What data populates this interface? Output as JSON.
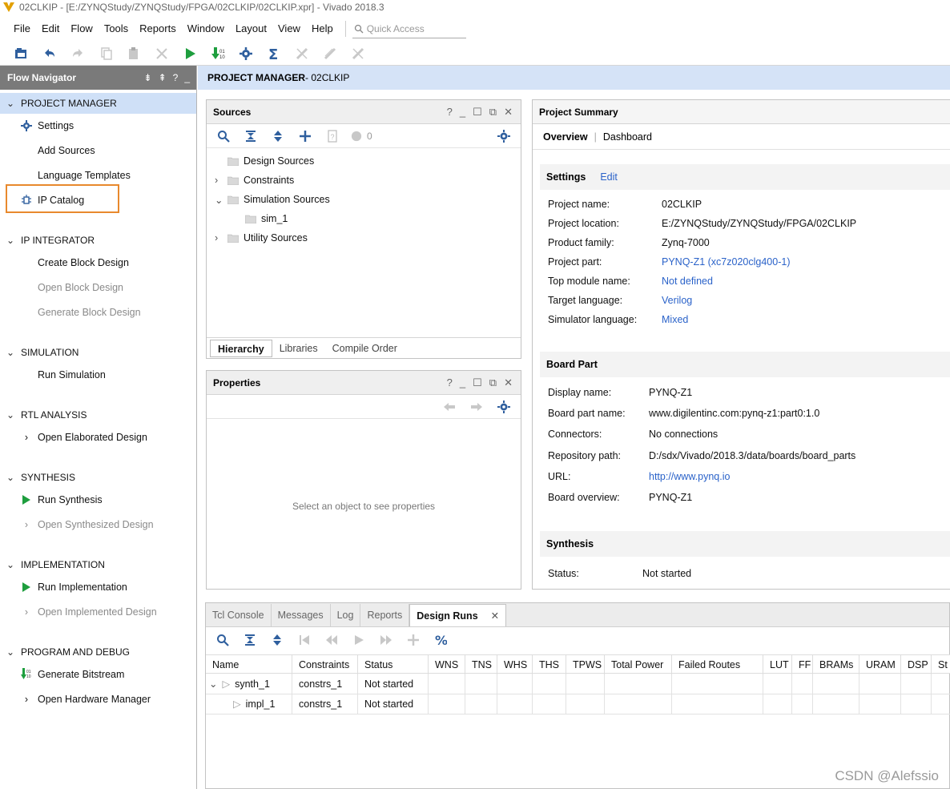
{
  "window": {
    "title": "02CLKIP - [E:/ZYNQStudy/ZYNQStudy/FPGA/02CLKIP/02CLKIP.xpr] - Vivado 2018.3"
  },
  "menu": {
    "items": [
      "File",
      "Edit",
      "Flow",
      "Tools",
      "Reports",
      "Window",
      "Layout",
      "View",
      "Help"
    ],
    "quick_access": "Quick Access"
  },
  "toolbar": {
    "icons": [
      "open-project-icon",
      "undo-icon",
      "redo-icon",
      "copy-icon",
      "paste-icon",
      "delete-icon",
      "run-icon",
      "generate-bitstream-icon",
      "settings-icon",
      "sigma-icon",
      "disabled-tool-1-icon",
      "disabled-tool-2-icon",
      "disabled-tool-3-icon"
    ]
  },
  "flow_nav": {
    "title": "Flow Navigator",
    "sections": {
      "project_manager": "PROJECT MANAGER",
      "ip_integrator": "IP INTEGRATOR",
      "simulation": "SIMULATION",
      "rtl_analysis": "RTL ANALYSIS",
      "synthesis": "SYNTHESIS",
      "implementation": "IMPLEMENTATION",
      "program_debug": "PROGRAM AND DEBUG"
    },
    "items": {
      "settings": "Settings",
      "add_sources": "Add Sources",
      "language_templates": "Language Templates",
      "ip_catalog": "IP Catalog",
      "create_block": "Create Block Design",
      "open_block": "Open Block Design",
      "generate_block": "Generate Block Design",
      "run_sim": "Run Simulation",
      "open_elab": "Open Elaborated Design",
      "run_synth": "Run Synthesis",
      "open_synth": "Open Synthesized Design",
      "run_impl": "Run Implementation",
      "open_impl": "Open Implemented Design",
      "gen_bit": "Generate Bitstream",
      "open_hw": "Open Hardware Manager"
    }
  },
  "header": {
    "pm_bold": "PROJECT MANAGER",
    "pm_rest": " - 02CLKIP"
  },
  "sources": {
    "title": "Sources",
    "badge_count": "0",
    "tree": {
      "design": "Design Sources",
      "constraints": "Constraints",
      "simulation": "Simulation Sources",
      "sim1": "sim_1",
      "utility": "Utility Sources"
    },
    "tabs": [
      "Hierarchy",
      "Libraries",
      "Compile Order"
    ]
  },
  "properties": {
    "title": "Properties",
    "empty": "Select an object to see properties"
  },
  "summary": {
    "title": "Project Summary",
    "tabs": [
      "Overview",
      "Dashboard"
    ],
    "settings_label": "Settings",
    "edit_label": "Edit",
    "settings": [
      {
        "k": "Project name:",
        "v": "02CLKIP"
      },
      {
        "k": "Project location:",
        "v": "E:/ZYNQStudy/ZYNQStudy/FPGA/02CLKIP"
      },
      {
        "k": "Product family:",
        "v": "Zynq-7000"
      },
      {
        "k": "Project part:",
        "v": "PYNQ-Z1 (xc7z020clg400-1)"
      },
      {
        "k": "Top module name:",
        "v": "Not defined"
      },
      {
        "k": "Target language:",
        "v": "Verilog"
      },
      {
        "k": "Simulator language:",
        "v": "Mixed"
      }
    ],
    "board_label": "Board Part",
    "board": [
      {
        "k": "Display name:",
        "v": "PYNQ-Z1"
      },
      {
        "k": "Board part name:",
        "v": "www.digilentinc.com:pynq-z1:part0:1.0"
      },
      {
        "k": "Connectors:",
        "v": "No connections"
      },
      {
        "k": "Repository path:",
        "v": "D:/sdx/Vivado/2018.3/data/boards/board_parts"
      },
      {
        "k": "URL:",
        "v": "http://www.pynq.io"
      },
      {
        "k": "Board overview:",
        "v": "PYNQ-Z1"
      }
    ],
    "synthesis_label": "Synthesis",
    "status_key": "Status:",
    "status_val": "Not started"
  },
  "runs": {
    "tabs": [
      "Tcl Console",
      "Messages",
      "Log",
      "Reports",
      "Design Runs"
    ],
    "columns": [
      "Name",
      "Constraints",
      "Status",
      "WNS",
      "TNS",
      "WHS",
      "THS",
      "TPWS",
      "Total Power",
      "Failed Routes",
      "LUT",
      "FF",
      "BRAMs",
      "URAM",
      "DSP",
      "St"
    ],
    "rows": [
      {
        "name": "synth_1",
        "constraints": "constrs_1",
        "status": "Not started"
      },
      {
        "name": "impl_1",
        "constraints": "constrs_1",
        "status": "Not started"
      }
    ]
  },
  "watermark": "CSDN @Alefssio"
}
